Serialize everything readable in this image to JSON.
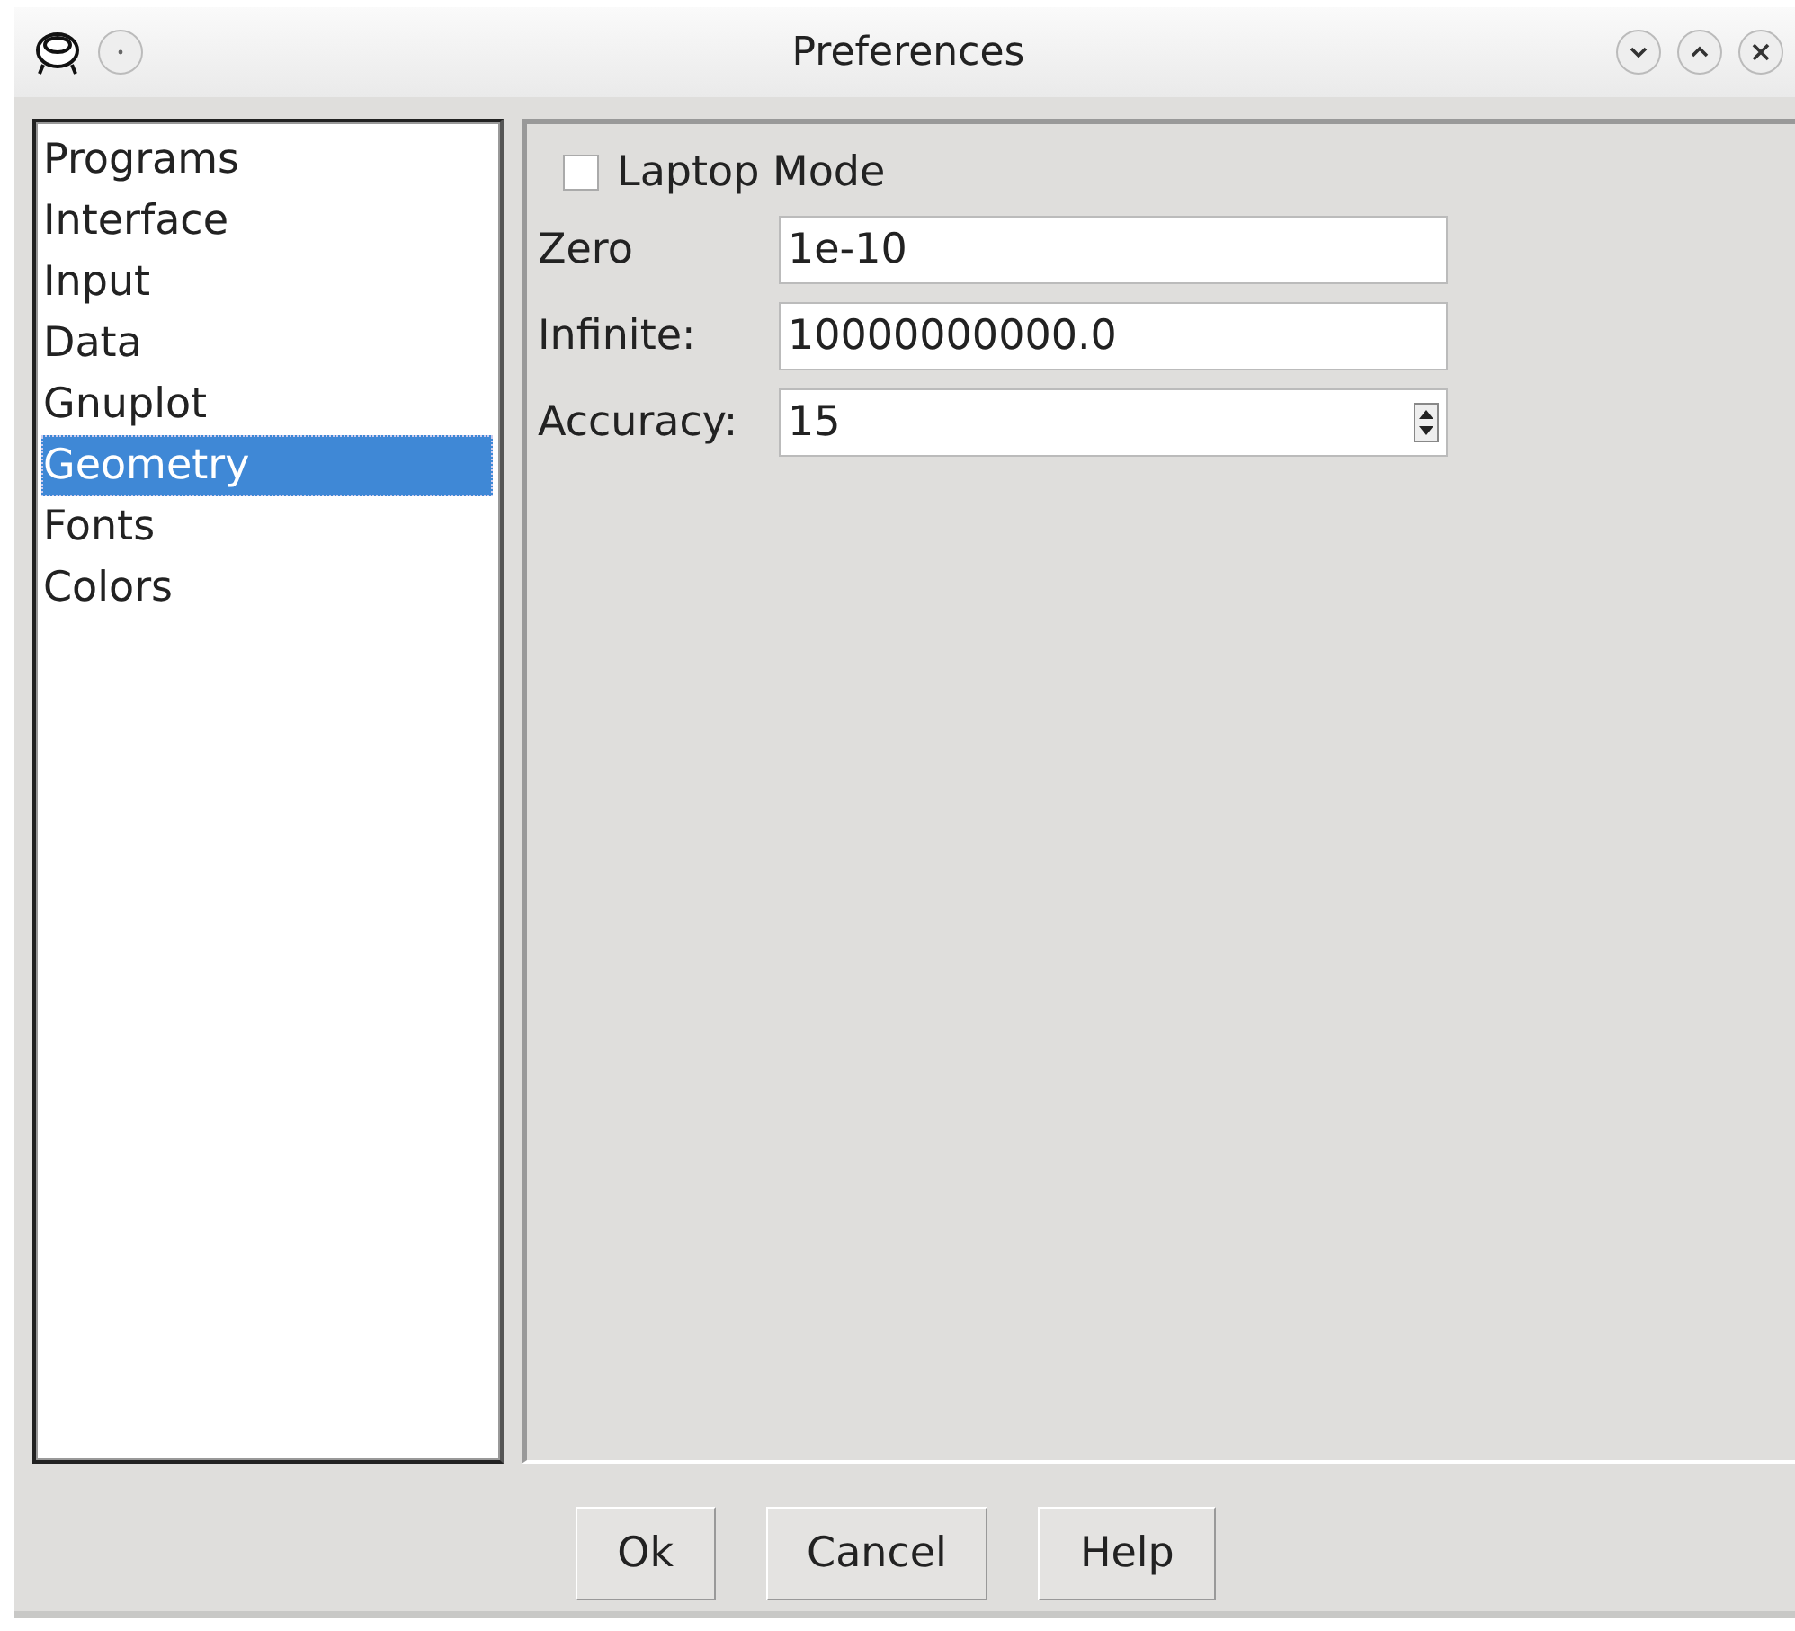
{
  "window": {
    "title": "Preferences"
  },
  "sidebar": {
    "items": [
      {
        "label": "Programs",
        "selected": false
      },
      {
        "label": "Interface",
        "selected": false
      },
      {
        "label": "Input",
        "selected": false
      },
      {
        "label": "Data",
        "selected": false
      },
      {
        "label": "Gnuplot",
        "selected": false
      },
      {
        "label": "Geometry",
        "selected": true
      },
      {
        "label": "Fonts",
        "selected": false
      },
      {
        "label": "Colors",
        "selected": false
      }
    ]
  },
  "panel": {
    "laptop_mode": {
      "label": "Laptop Mode",
      "checked": false
    },
    "fields": [
      {
        "kind": "text",
        "label": "Zero",
        "value": "1e-10"
      },
      {
        "kind": "text",
        "label": "Infinite:",
        "value": "10000000000.0"
      },
      {
        "kind": "spin",
        "label": "Accuracy:",
        "value": "15"
      }
    ]
  },
  "buttons": [
    "Ok",
    "Cancel",
    "Help"
  ]
}
